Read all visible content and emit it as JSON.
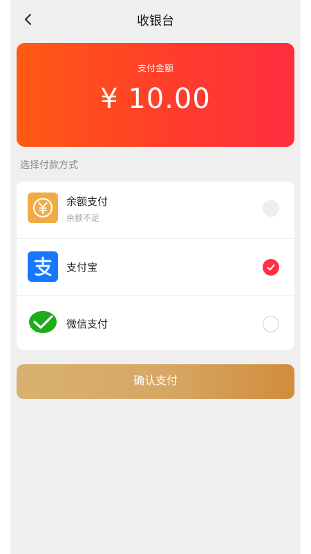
{
  "header": {
    "title": "收银台",
    "back_icon": "chevron-left-icon"
  },
  "amount_card": {
    "label": "支付金额",
    "value": "¥ 10.00"
  },
  "section_title": "选择付款方式",
  "methods": [
    {
      "name": "余额支付",
      "sub": "余额不足",
      "icon": "yuan-coin-icon",
      "state": "disabled"
    },
    {
      "name": "支付宝",
      "icon": "alipay-icon",
      "state": "checked"
    },
    {
      "name": "微信支付",
      "icon": "wechat-pay-icon",
      "state": "unchecked"
    }
  ],
  "confirm_button": {
    "label": "确认支付"
  },
  "colors": {
    "accent_red": "#ff2f45",
    "amount_gradient_start": "#ff5a12",
    "amount_gradient_end": "#ff2f3f",
    "button_gold": "#d8b171",
    "alipay_blue": "#1677ff",
    "wechat_green": "#1aad19",
    "balance_orange": "#f0ab44"
  }
}
